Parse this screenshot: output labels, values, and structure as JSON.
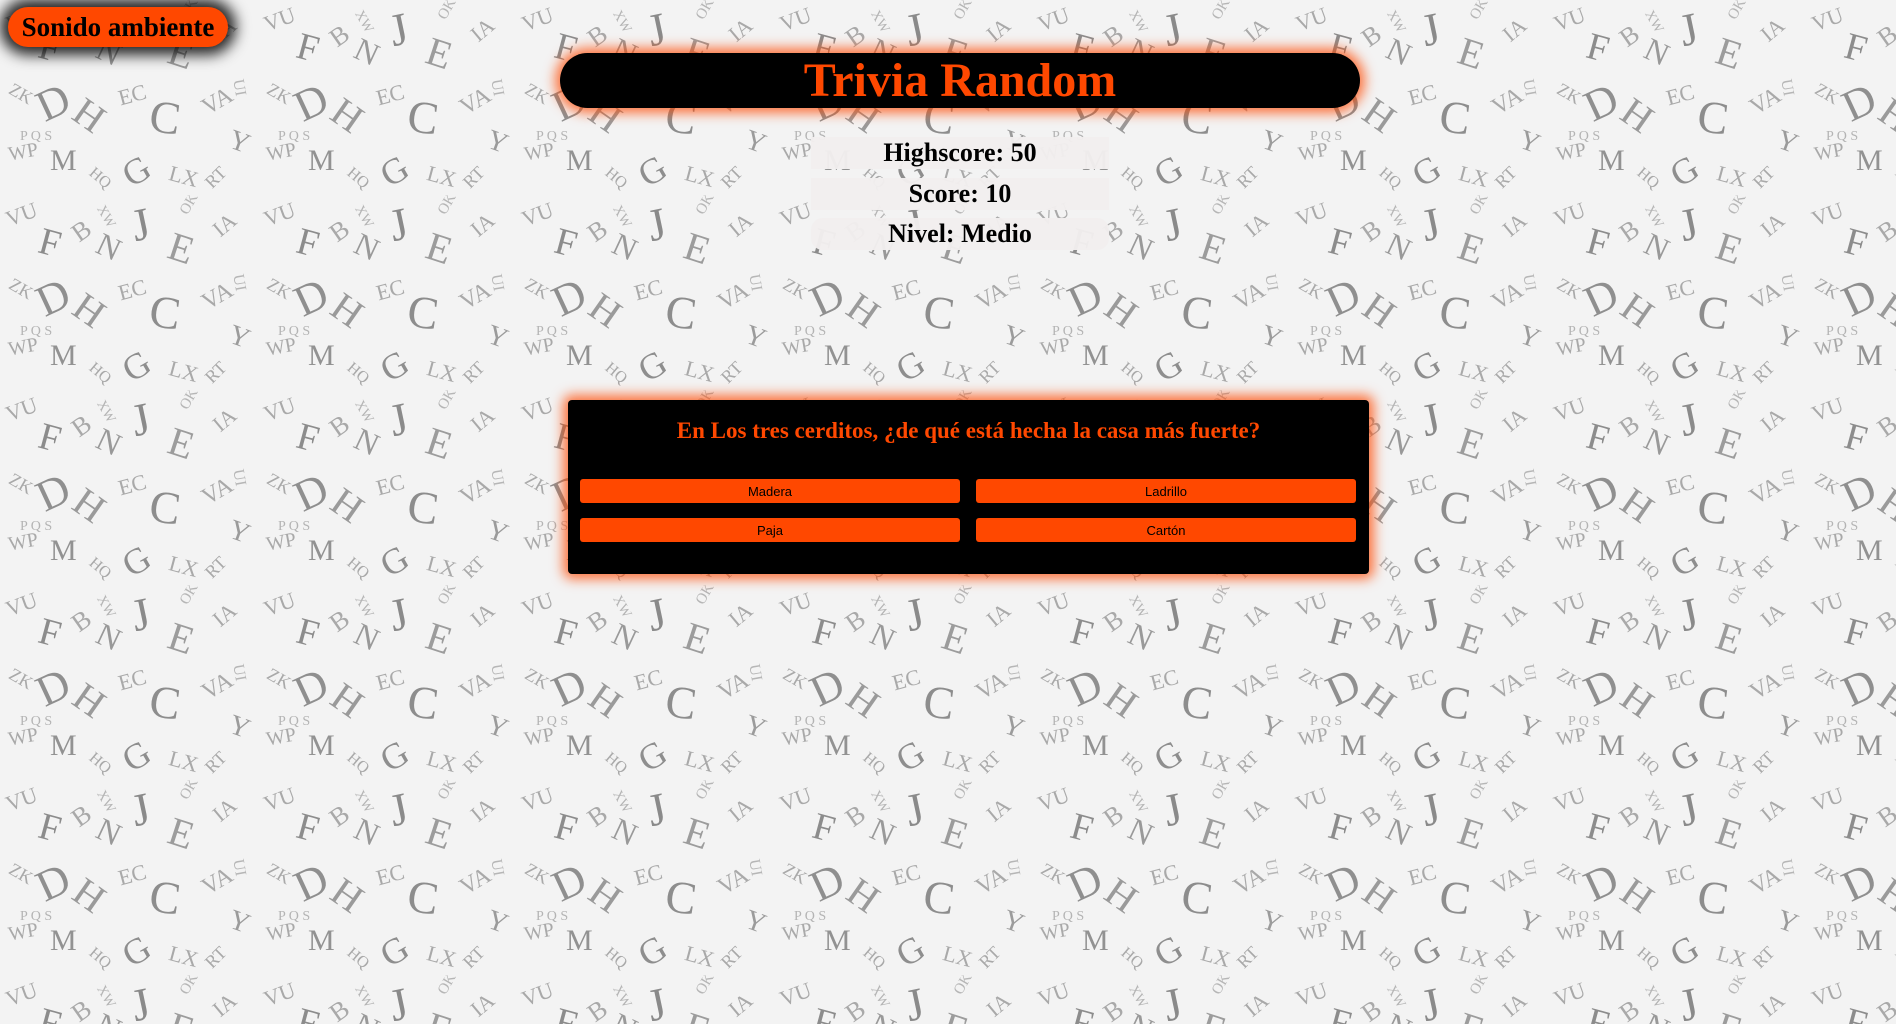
{
  "sound_button": {
    "label": "Sonido ambiente"
  },
  "title": "Trivia Random",
  "stats": {
    "highscore": "Highscore: 50",
    "score": "Score: 10",
    "level": "Nivel: Medio"
  },
  "question": {
    "text": "En Los tres cerditos, ¿de qué está hecha la casa más fuerte?",
    "answers": [
      "Madera",
      "Ladrillo",
      "Paja",
      "Cartón"
    ]
  },
  "colors": {
    "accent": "#ff4800",
    "panel": "#000000",
    "stat_background": "#f1eeee"
  }
}
